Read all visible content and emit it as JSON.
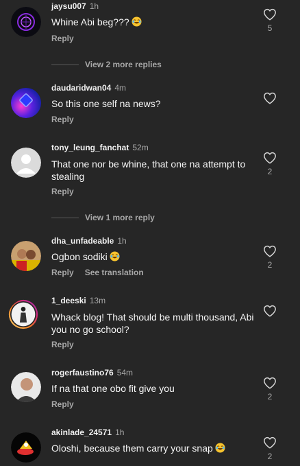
{
  "view_replies_label_1": "View 2 more replies",
  "view_replies_label_2": "View 1 more reply",
  "comments": [
    {
      "username": "jaysu007",
      "time": "1h",
      "text": "Whine Abi beg???",
      "emoji": "face-with-tears-of-joy",
      "reply": "Reply",
      "likes": "5"
    },
    {
      "username": "daudaridwan04",
      "time": "4m",
      "text": "So this one self na news?",
      "reply": "Reply",
      "likes": ""
    },
    {
      "username": "tony_leung_fanchat",
      "time": "52m",
      "text": "That one nor be whine, that one na attempt to stealing",
      "reply": "Reply",
      "likes": "2"
    },
    {
      "username": "dha_unfadeable",
      "time": "1h",
      "text": "Ogbon sodiki",
      "emoji": "face-with-tears-of-joy",
      "reply": "Reply",
      "see_translation": "See translation",
      "likes": "2"
    },
    {
      "username": "1_deeski",
      "time": "13m",
      "text": "Whack blog! That should be multi thousand, Abi you no go school?",
      "reply": "Reply",
      "likes": ""
    },
    {
      "username": "rogerfaustino76",
      "time": "54m",
      "text": "If na that one obo fit give you",
      "reply": "Reply",
      "likes": "2"
    },
    {
      "username": "akinlade_24571",
      "time": "1h",
      "text": "Oloshi, because them carry your snap",
      "emoji": "face-with-tears-of-joy",
      "likes": "2"
    }
  ],
  "colors": {
    "background": "#262626",
    "primary_text": "#f5f5f5",
    "secondary_text": "#a8a8a8",
    "story_ring": "#c13584"
  }
}
